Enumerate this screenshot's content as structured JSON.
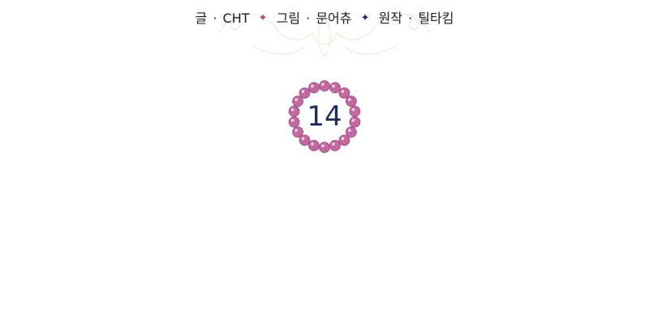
{
  "credits": {
    "writer_label": "글",
    "writer_name": "CHT",
    "artist_label": "그림",
    "artist_name": "문어츄",
    "original_label": "원작",
    "original_name": "틸타킴",
    "separator": "·",
    "star_glyph": "✦",
    "star_color_1": "#b0426e",
    "star_color_2": "#1f2b59"
  },
  "chapter": {
    "number": "14",
    "number_color": "#1f2b59",
    "bead_color": "#c06aa0",
    "bead_stroke": "#9c4a82"
  },
  "ornament": {
    "color": "#f0dede"
  }
}
